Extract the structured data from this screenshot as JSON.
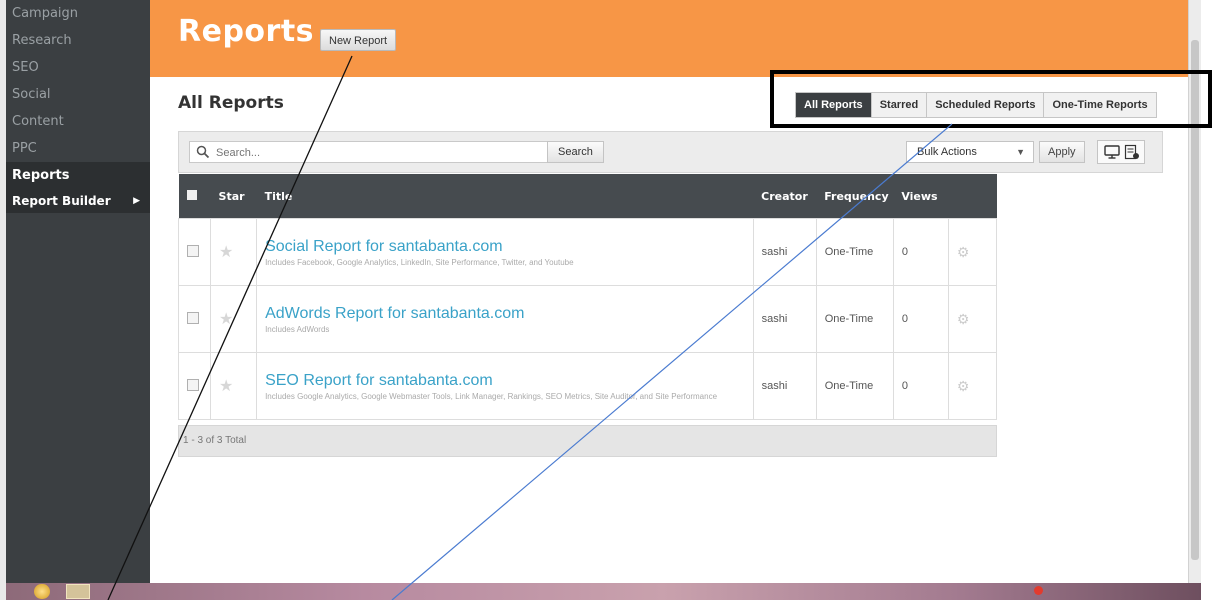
{
  "sidebar": {
    "items": [
      {
        "label": "Campaign"
      },
      {
        "label": "Research"
      },
      {
        "label": "SEO"
      },
      {
        "label": "Social"
      },
      {
        "label": "Content"
      },
      {
        "label": "PPC"
      },
      {
        "label": "Reports"
      }
    ],
    "sub_item": {
      "label": "Report Builder",
      "icon": "chevron-right-icon"
    }
  },
  "header": {
    "title": "Reports",
    "new_button": "New Report",
    "background_color": "#f79646"
  },
  "page_title": "All Reports",
  "tabs": [
    {
      "label": "All Reports",
      "active": true
    },
    {
      "label": "Starred",
      "active": false
    },
    {
      "label": "Scheduled Reports",
      "active": false
    },
    {
      "label": "One-Time Reports",
      "active": false
    }
  ],
  "toolbar": {
    "search_placeholder": "Search...",
    "search_button": "Search",
    "bulk_actions": "Bulk Actions",
    "apply": "Apply",
    "icons": [
      "search-icon",
      "monitor-icon",
      "export-icon"
    ]
  },
  "table": {
    "columns": [
      "",
      "Star",
      "Title",
      "Creator",
      "Frequency",
      "Views",
      ""
    ],
    "rows": [
      {
        "title": "Social Report for santabanta.com",
        "description": "Includes Facebook, Google Analytics, LinkedIn, Site Performance, Twitter, and Youtube",
        "creator": "sashi",
        "frequency": "One-Time",
        "views": "0"
      },
      {
        "title": "AdWords Report for santabanta.com",
        "description": "Includes AdWords",
        "creator": "sashi",
        "frequency": "One-Time",
        "views": "0"
      },
      {
        "title": "SEO Report for santabanta.com",
        "description": "Includes Google Analytics, Google Webmaster Tools, Link Manager, Rankings, SEO Metrics, Site Auditor, and Site Performance",
        "creator": "sashi",
        "frequency": "One-Time",
        "views": "0"
      }
    ],
    "footer": "1 - 3 of 3 Total"
  },
  "colors": {
    "accent_orange": "#f79646",
    "sidebar_dark": "#3b3f42",
    "link_blue": "#3aa2c8"
  }
}
